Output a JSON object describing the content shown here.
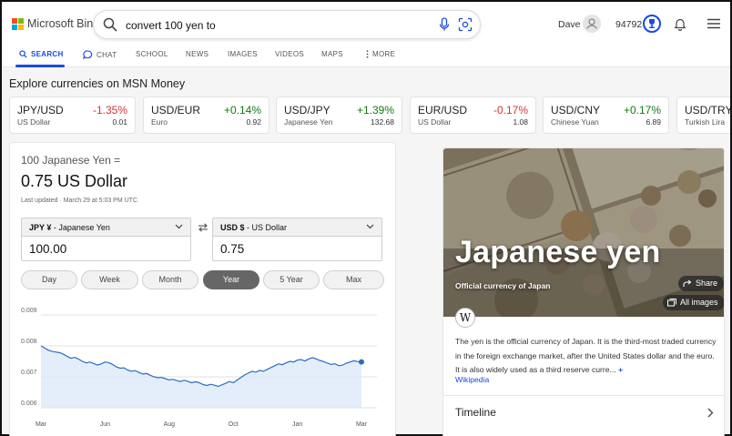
{
  "header": {
    "logo_text": "Microsoft Bing",
    "logo_colors": [
      "#f25022",
      "#7fba00",
      "#00a4ef",
      "#ffb900"
    ],
    "search_query": "convert 100 yen to",
    "user_name": "Dave",
    "reward_points": "94792",
    "accent_color": "#174ae4"
  },
  "nav": {
    "items": [
      {
        "label": "SEARCH",
        "icon": "search-icon"
      },
      {
        "label": "CHAT",
        "icon": "chat-icon"
      },
      {
        "label": "SCHOOL"
      },
      {
        "label": "NEWS"
      },
      {
        "label": "IMAGES"
      },
      {
        "label": "VIDEOS"
      },
      {
        "label": "MAPS"
      },
      {
        "label": "MORE",
        "icon": "more-icon"
      }
    ]
  },
  "explore": {
    "title": "Explore currencies on MSN Money",
    "cards": [
      {
        "pair": "JPY/USD",
        "change": "-1.35%",
        "direction": "down",
        "name": "US Dollar",
        "rate": "0.01"
      },
      {
        "pair": "USD/EUR",
        "change": "+0.14%",
        "direction": "up",
        "name": "Euro",
        "rate": "0.92"
      },
      {
        "pair": "USD/JPY",
        "change": "+1.39%",
        "direction": "up",
        "name": "Japanese Yen",
        "rate": "132.68"
      },
      {
        "pair": "EUR/USD",
        "change": "-0.17%",
        "direction": "down",
        "name": "US Dollar",
        "rate": "1.08"
      },
      {
        "pair": "USD/CNY",
        "change": "+0.17%",
        "direction": "up",
        "name": "Chinese Yuan",
        "rate": "6.89"
      },
      {
        "pair": "USD/TRY",
        "change": "",
        "direction": "up",
        "name": "Turkish Lira",
        "rate": ""
      }
    ]
  },
  "converter": {
    "from_text": "100 Japanese Yen =",
    "result_text": "0.75 US Dollar",
    "updated": "Last updated · March 29 at 5:03 PM UTC",
    "from_currency": {
      "code": "JPY ¥",
      "name": " - Japanese Yen",
      "amount": "100.00"
    },
    "to_currency": {
      "code": "USD $",
      "name": " - US Dollar",
      "amount": "0.75"
    },
    "ranges": [
      "Day",
      "Week",
      "Month",
      "Year",
      "5 Year",
      "Max"
    ],
    "active_range": "Year"
  },
  "chart_data": {
    "type": "area",
    "xlabels": [
      "Mar",
      "Jun",
      "Aug",
      "Oct",
      "Jan",
      "Mar"
    ],
    "ylabels": [
      "0.009",
      "0.008",
      "0.007",
      "0.006"
    ],
    "ylim": [
      0.006,
      0.009
    ],
    "grid": true,
    "line_color": "#2b6cc4",
    "fill_color": "#dbe8f8",
    "values": [
      0.008,
      0.00793,
      0.00786,
      0.00782,
      0.0078,
      0.00778,
      0.00773,
      0.00766,
      0.0076,
      0.00763,
      0.00757,
      0.0075,
      0.00745,
      0.00748,
      0.00743,
      0.00738,
      0.00742,
      0.00748,
      0.00746,
      0.0074,
      0.00732,
      0.00728,
      0.00729,
      0.00722,
      0.00718,
      0.0072,
      0.00714,
      0.00709,
      0.00711,
      0.00705,
      0.007,
      0.00697,
      0.00698,
      0.00694,
      0.0069,
      0.00692,
      0.00688,
      0.00685,
      0.00689,
      0.00685,
      0.00681,
      0.00684,
      0.00681,
      0.00675,
      0.00672,
      0.00676,
      0.00673,
      0.00669,
      0.00674,
      0.00679,
      0.00685,
      0.00681,
      0.00689,
      0.00698,
      0.00706,
      0.00712,
      0.00718,
      0.00715,
      0.00721,
      0.00718,
      0.00724,
      0.0073,
      0.00736,
      0.00742,
      0.00739,
      0.00745,
      0.0075,
      0.00748,
      0.00754,
      0.00756,
      0.00751,
      0.00758,
      0.00762,
      0.00758,
      0.00753,
      0.00749,
      0.00744,
      0.0074,
      0.00742,
      0.00736,
      0.00738,
      0.00744,
      0.00748,
      0.00752,
      0.00749,
      0.00748
    ]
  },
  "knowledge": {
    "title": "Japanese yen",
    "subtitle": "Official currency of Japan",
    "share_label": "Share",
    "images_label": "All images",
    "wiki_glyph": "W",
    "description": "The yen is the official currency of Japan. It is the third-most traded currency in the foreign exchange market, after the United States dollar and the euro. It is also widely used as a third reserve curre...",
    "more": "+",
    "source": "Wikipedia",
    "timeline_label": "Timeline"
  }
}
